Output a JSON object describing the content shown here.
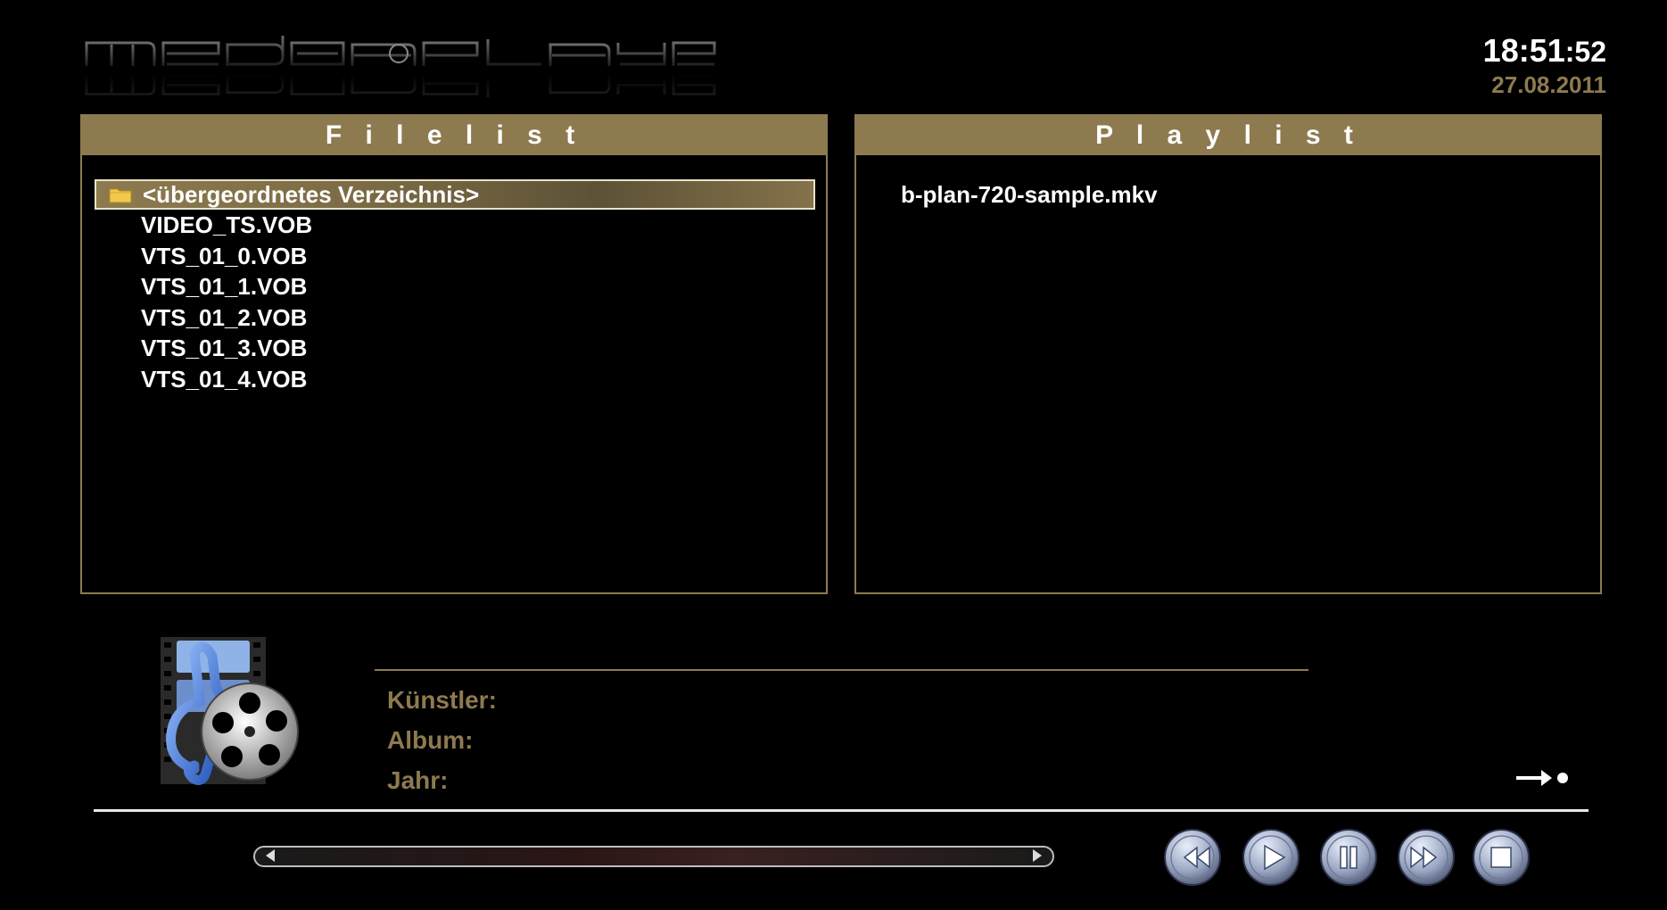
{
  "header": {
    "logo_text": "mediaplayer",
    "clock_hm": "18:51",
    "clock_sec": ":52",
    "date": "27.08.2011"
  },
  "filelist": {
    "title": "F i l e l i s t",
    "items": [
      {
        "label": "<übergeordnetes Verzeichnis>",
        "icon": "folder-icon",
        "selected": true
      },
      {
        "label": "VIDEO_TS.VOB"
      },
      {
        "label": "VTS_01_0.VOB"
      },
      {
        "label": "VTS_01_1.VOB"
      },
      {
        "label": "VTS_01_2.VOB"
      },
      {
        "label": "VTS_01_3.VOB"
      },
      {
        "label": "VTS_01_4.VOB"
      }
    ]
  },
  "playlist": {
    "title": "P l a y l i s t",
    "items": [
      {
        "label": "b-plan-720-sample.mkv"
      }
    ]
  },
  "info": {
    "artist_label": "Künstler:",
    "album_label": "Album:",
    "year_label": "Jahr:"
  },
  "playback": {
    "progress": 0.0
  },
  "controls": [
    "rewind-icon",
    "play-icon",
    "pause-icon",
    "fast-forward-icon",
    "stop-icon"
  ],
  "colors": {
    "accent": "#8d7a4f",
    "background": "#000000",
    "text": "#ffffff"
  }
}
